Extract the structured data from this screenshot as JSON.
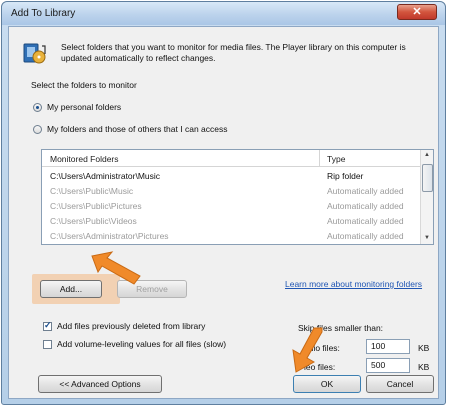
{
  "window": {
    "title": "Add To Library",
    "close_glyph": "✕"
  },
  "header": {
    "description": "Select folders that you want to monitor for media files. The Player library on this computer is updated automatically to reflect changes."
  },
  "monitor_section": {
    "label": "Select the folders to monitor",
    "options": [
      {
        "label": "My personal folders",
        "checked": true
      },
      {
        "label": "My folders and those of others that I can access",
        "checked": false
      }
    ]
  },
  "folders_list": {
    "columns": [
      "Monitored Folders",
      "Type"
    ],
    "rows": [
      {
        "folder": "C:\\Users\\Administrator\\Music",
        "type": "Rip folder"
      },
      {
        "folder": "C:\\Users\\Public\\Music",
        "type": "Automatically added"
      },
      {
        "folder": "C:\\Users\\Public\\Pictures",
        "type": "Automatically added"
      },
      {
        "folder": "C:\\Users\\Public\\Videos",
        "type": "Automatically added"
      },
      {
        "folder": "C:\\Users\\Administrator\\Pictures",
        "type": "Automatically added"
      }
    ]
  },
  "buttons": {
    "add": "Add...",
    "remove": "Remove",
    "advanced": "<< Advanced Options",
    "ok": "OK",
    "cancel": "Cancel"
  },
  "link": {
    "learn_more": "Learn more about monitoring folders"
  },
  "options": {
    "add_deleted": {
      "label": "Add files previously deleted from library",
      "checked": true
    },
    "volume_leveling": {
      "label": "Add volume-leveling values for all files (slow)",
      "checked": false
    }
  },
  "skip": {
    "label": "Skip files smaller than:",
    "audio_label": "udio files:",
    "audio_value": "100",
    "video_label": "leo files:",
    "video_value": "500",
    "unit": "KB"
  },
  "colors": {
    "annotation_arrow": "#f08a2a",
    "highlight": "#f4b882",
    "link": "#1f55b3"
  }
}
